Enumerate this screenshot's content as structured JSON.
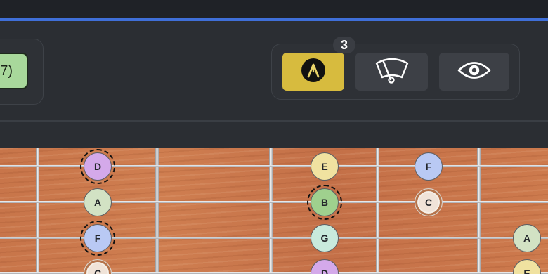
{
  "toolbar": {
    "chord_label": "7)",
    "badge_count": "3",
    "mode_buttons": [
      {
        "name": "autotune",
        "icon": "a-circle-icon",
        "active": true
      },
      {
        "name": "tuner",
        "icon": "tuner-gauge-icon",
        "active": false
      },
      {
        "name": "visibility",
        "icon": "eye-icon",
        "active": false
      }
    ]
  },
  "colors": {
    "accent_line": "#3f6fd8",
    "active_button": "#d7bb3e",
    "chord_chip": "#a8d89b",
    "note_D": "#d4a9ea",
    "note_E": "#f0e2a0",
    "note_F": "#b9c9f4",
    "note_A": "#d2e2c4",
    "note_B": "#9fd08e",
    "note_G": "#c8eadc",
    "note_C": "#f0e3d8"
  },
  "fretboard": {
    "notes": [
      {
        "label": "D"
      },
      {
        "label": "A"
      },
      {
        "label": "F"
      },
      {
        "label": "C"
      },
      {
        "label": "E"
      },
      {
        "label": "B"
      },
      {
        "label": "G"
      },
      {
        "label": "D"
      },
      {
        "label": "F"
      },
      {
        "label": "C"
      },
      {
        "label": "A"
      },
      {
        "label": "E"
      }
    ]
  }
}
